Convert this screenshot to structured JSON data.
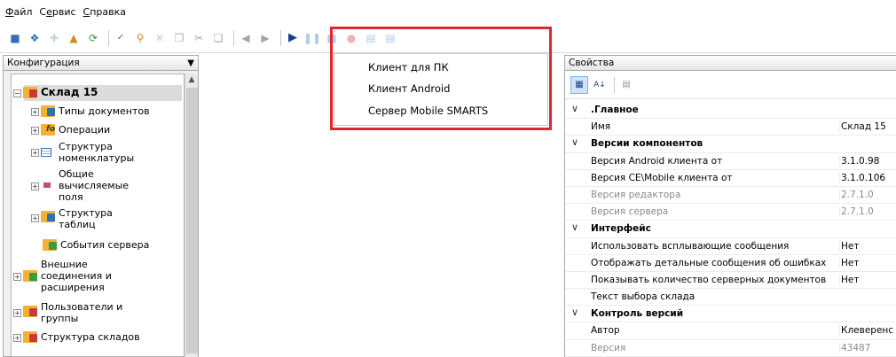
{
  "menu": {
    "items": [
      {
        "mnemonic": "Ф",
        "rest": "айл"
      },
      {
        "mnemonic": "",
        "pre": "С",
        "mn": "е",
        "rest": "рвис"
      },
      {
        "mnemonic": "С",
        "rest": "правка"
      }
    ],
    "file_first": "Ф",
    "file_rest": "айл",
    "service_first": "С",
    "service_mn": "е",
    "service_rest": "рвис",
    "help_first": "С",
    "help_rest": "правка"
  },
  "left_panel": {
    "title": "Конфигурация",
    "pin": "ᵽ",
    "tree": {
      "root": "Склад 15",
      "doc_types": "Типы документов",
      "operations": "Операции",
      "nomenclature_line1": "Структура",
      "nomenclature_line2": "номенклатуры",
      "fields_line1": "Общие",
      "fields_line2": "вычисляемые",
      "fields_line3": "поля",
      "tables_line1": "Структура",
      "tables_line2": "таблиц",
      "server_events": "События сервера",
      "ext_line1": "Внешние",
      "ext_line2": "соединения и",
      "ext_line3": "расширения",
      "users_line1": "Пользователи и",
      "users_line2": "группы",
      "warehouses": "Структура складов"
    }
  },
  "dropdown": {
    "items": [
      "Клиент для ПК",
      "Клиент Android",
      "Сервер Mobile SMARTS"
    ]
  },
  "properties": {
    "title": "Свойства",
    "rows": [
      {
        "type": "group",
        "label": ".Главное"
      },
      {
        "type": "row",
        "key": "Имя",
        "value": "Склад 15",
        "dim": false
      },
      {
        "type": "group",
        "label": "Версии компонентов"
      },
      {
        "type": "row",
        "key": "Версия Android клиента от",
        "value": "3.1.0.98",
        "dim": false
      },
      {
        "type": "row",
        "key": "Версия CE\\Mobile клиента от",
        "value": "3.1.0.106",
        "dim": false
      },
      {
        "type": "row",
        "key": "Версия редактора",
        "value": "2.7.1.0",
        "dim": true
      },
      {
        "type": "row",
        "key": "Версия сервера",
        "value": "2.7.1.0",
        "dim": true
      },
      {
        "type": "group",
        "label": "Интерфейс"
      },
      {
        "type": "row",
        "key": "Использовать всплывающие сообщения",
        "value": "Нет",
        "dim": false
      },
      {
        "type": "row",
        "key": "Отображать детальные сообщения об ошибках",
        "value": "Нет",
        "dim": false
      },
      {
        "type": "row",
        "key": "Показывать количество серверных документов",
        "value": "Нет",
        "dim": false
      },
      {
        "type": "row",
        "key": "Текст выбора склада",
        "value": "",
        "dim": false
      },
      {
        "type": "group",
        "label": "Контроль версий"
      },
      {
        "type": "row",
        "key": "Автор",
        "value": "Клеверенс",
        "dim": false
      },
      {
        "type": "row",
        "key": "Версия",
        "value": "43487",
        "dim": true
      }
    ]
  },
  "colors": {
    "highlight": "#e3262e",
    "selection": "#dcdcdc"
  }
}
